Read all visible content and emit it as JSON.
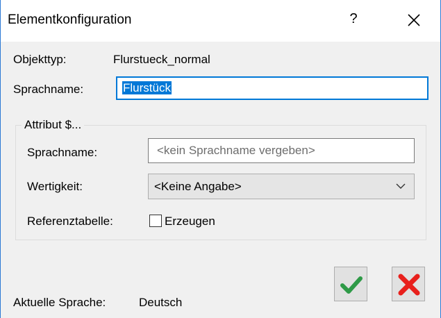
{
  "window": {
    "title": "Elementkonfiguration",
    "help_label": "?"
  },
  "object": {
    "type_label": "Objekttyp:",
    "type_value": "Flurstueck_normal",
    "language_name_label": "Sprachname:",
    "language_name_value": "Flurstück"
  },
  "attribute_group": {
    "title": "Attribut $...",
    "language_name_label": "Sprachname:",
    "language_name_placeholder": "<kein Sprachname vergeben>",
    "weight_label": "Wertigkeit:",
    "weight_selected": "<Keine Angabe>",
    "reference_label": "Referenztabelle:",
    "create_label": "Erzeugen",
    "create_checked": false
  },
  "footer": {
    "current_language_label": "Aktuelle Sprache:",
    "current_language_value": "Deutsch"
  },
  "colors": {
    "accent": "#0078d7",
    "ok_green": "#2e9a47",
    "cancel_red": "#e8201c"
  },
  "icons": {
    "ok": "checkmark-icon",
    "cancel": "x-cross-icon",
    "close": "close-icon",
    "dropdown": "chevron-down-icon"
  }
}
